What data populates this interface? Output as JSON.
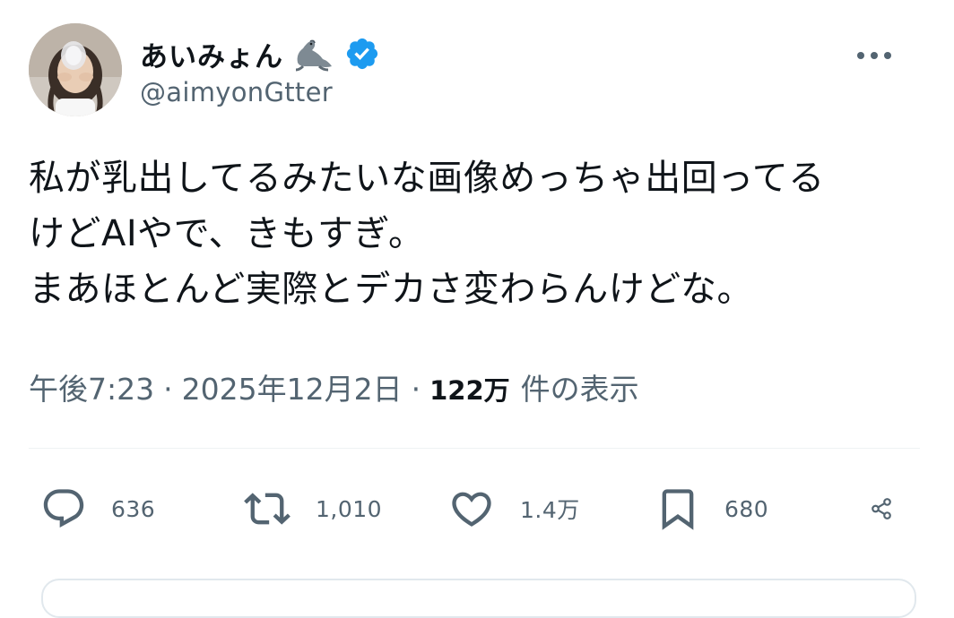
{
  "author": {
    "display_name": "あいみょん",
    "handle": "@aimyonGtter",
    "verified": true,
    "name_emoji": "seal-emoji",
    "avatar": "avatar-photo"
  },
  "tweet": {
    "lines": [
      "私が乳出してるみたいな画像めっちゃ出回ってる",
      "けどAIやで、きもすぎ。",
      "まあほとんど実際とデカさ変わらんけどな。"
    ]
  },
  "meta": {
    "time": "午後7:23",
    "separator": "·",
    "date": "2025年12月2日",
    "views_count": "122万",
    "views_label": "件の表示"
  },
  "actions": {
    "replies": "636",
    "reposts": "1,010",
    "likes": "1.4万",
    "bookmarks": "680"
  },
  "icons": {
    "reply": "reply-icon",
    "repost": "repost-icon",
    "like": "heart-icon",
    "bookmark": "bookmark-icon",
    "share": "share-icon",
    "more": "more-icon",
    "verified": "verified-badge-icon"
  },
  "colors": {
    "text": "#0f1419",
    "secondary": "#536471",
    "verified_blue": "#1d9bf0",
    "divider": "#eff3f4"
  }
}
